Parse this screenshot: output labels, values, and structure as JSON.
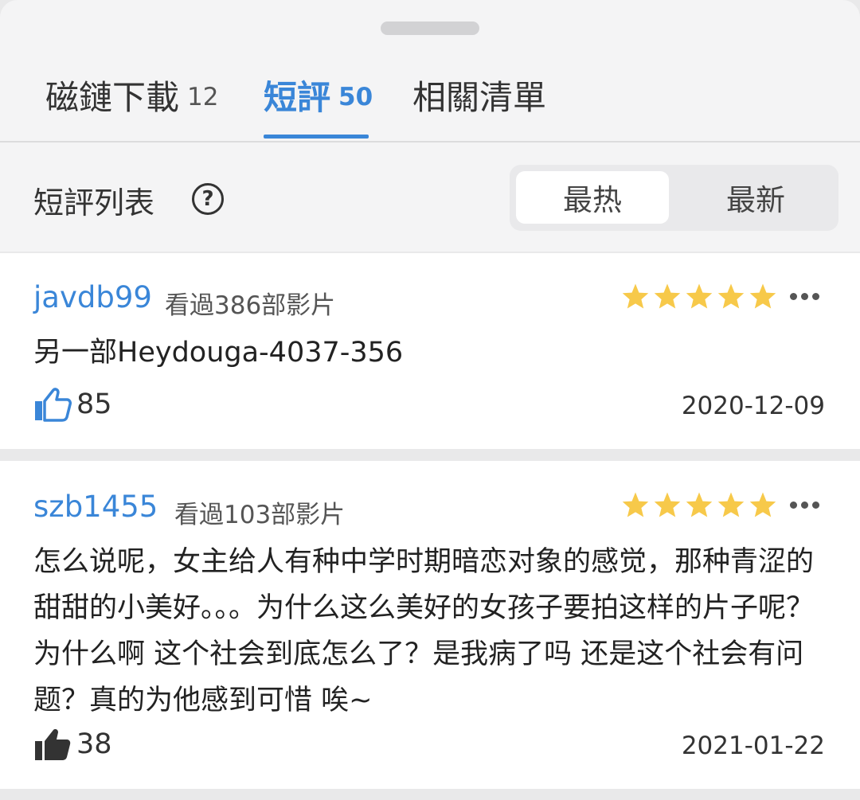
{
  "tabs": [
    {
      "label": "磁鏈下載",
      "count": "12"
    },
    {
      "label": "短評",
      "count": "50"
    },
    {
      "label": "相關清單"
    }
  ],
  "list": {
    "title": "短評列表",
    "help_icon": "question-circle-icon",
    "sort_options": [
      "最热",
      "最新"
    ],
    "selected_sort": "最热"
  },
  "reviews": [
    {
      "username": "javdb99",
      "watched": "看過386部影片",
      "rating": 5,
      "content": "另一部Heydouga-4037-356",
      "likes": "85",
      "date": "2020-12-09",
      "liked": false
    },
    {
      "username": "szb1455",
      "watched": "看過103部影片",
      "rating": 5,
      "content": "怎么说呢，女主给人有种中学时期暗恋对象的感觉，那种青涩的甜甜的小美好。。。为什么这么美好的女孩子要拍这样的片子呢？为什么啊  这个社会到底怎么了？是我病了吗  还是这个社会有问题？真的为他感到可惜  唉~",
      "likes": "38",
      "date": "2021-01-22",
      "liked": true
    }
  ],
  "colors": {
    "accent": "#3a86d8",
    "star": "#f7c94a",
    "like_filled": "#333333"
  }
}
